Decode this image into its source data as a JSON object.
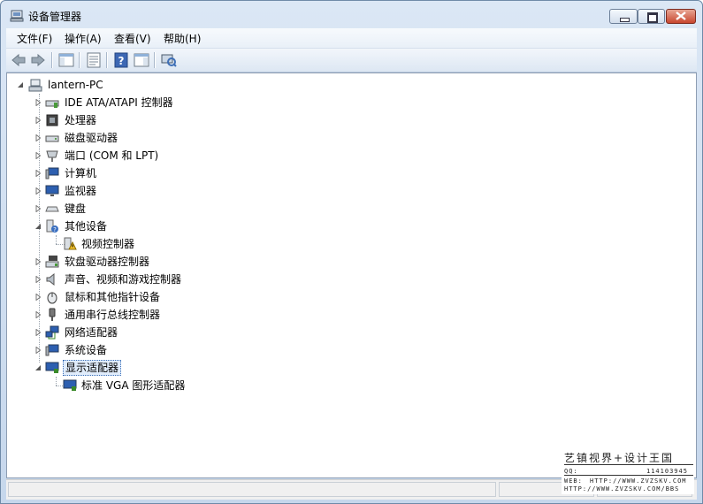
{
  "window": {
    "title": "设备管理器"
  },
  "menu": [
    {
      "label": "文件(F)"
    },
    {
      "label": "操作(A)"
    },
    {
      "label": "查看(V)"
    },
    {
      "label": "帮助(H)"
    }
  ],
  "toolbar": {
    "buttons": [
      "back-icon",
      "forward-icon",
      "console-tree-icon",
      "properties-icon",
      "help-icon",
      "action-pane-icon",
      "scan-hardware-icon"
    ]
  },
  "tree": {
    "root": "lantern-PC",
    "items": [
      {
        "label": "IDE ATA/ATAPI 控制器",
        "icon": "ide-controller-icon",
        "expanded": false
      },
      {
        "label": "处理器",
        "icon": "processor-icon",
        "expanded": false
      },
      {
        "label": "磁盘驱动器",
        "icon": "disk-drive-icon",
        "expanded": false
      },
      {
        "label": "端口 (COM 和 LPT)",
        "icon": "port-icon",
        "expanded": false
      },
      {
        "label": "计算机",
        "icon": "computer-icon",
        "expanded": false
      },
      {
        "label": "监视器",
        "icon": "monitor-icon",
        "expanded": false
      },
      {
        "label": "键盘",
        "icon": "keyboard-icon",
        "expanded": false
      },
      {
        "label": "其他设备",
        "icon": "other-devices-icon",
        "expanded": true
      },
      {
        "label": "视频控制器",
        "icon": "warning-device-icon",
        "child": true
      },
      {
        "label": "软盘驱动器控制器",
        "icon": "floppy-controller-icon",
        "expanded": false
      },
      {
        "label": "声音、视频和游戏控制器",
        "icon": "sound-icon",
        "expanded": false
      },
      {
        "label": "鼠标和其他指针设备",
        "icon": "mouse-icon",
        "expanded": false
      },
      {
        "label": "通用串行总线控制器",
        "icon": "usb-icon",
        "expanded": false
      },
      {
        "label": "网络适配器",
        "icon": "network-adapter-icon",
        "expanded": false
      },
      {
        "label": "系统设备",
        "icon": "system-device-icon",
        "expanded": false
      },
      {
        "label": "显示适配器",
        "icon": "display-adapter-icon",
        "expanded": true,
        "selected": true
      },
      {
        "label": "标准 VGA 图形适配器",
        "icon": "display-adapter-icon",
        "child": true
      }
    ]
  },
  "watermark": {
    "title": "艺镇视界+设计王国",
    "qq_label": "QQ:",
    "qq_value": "114103945",
    "web_label": "WEB:",
    "web_value": "HTTP://WWW.ZVZSKV.COM",
    "bbs": "HTTP://WWW.ZVZSKV.COM/BBS"
  },
  "colors": {
    "selection": "#e0ecfb",
    "title_gradient_top": "#dbe7f5",
    "close_button": "#c8472f"
  }
}
